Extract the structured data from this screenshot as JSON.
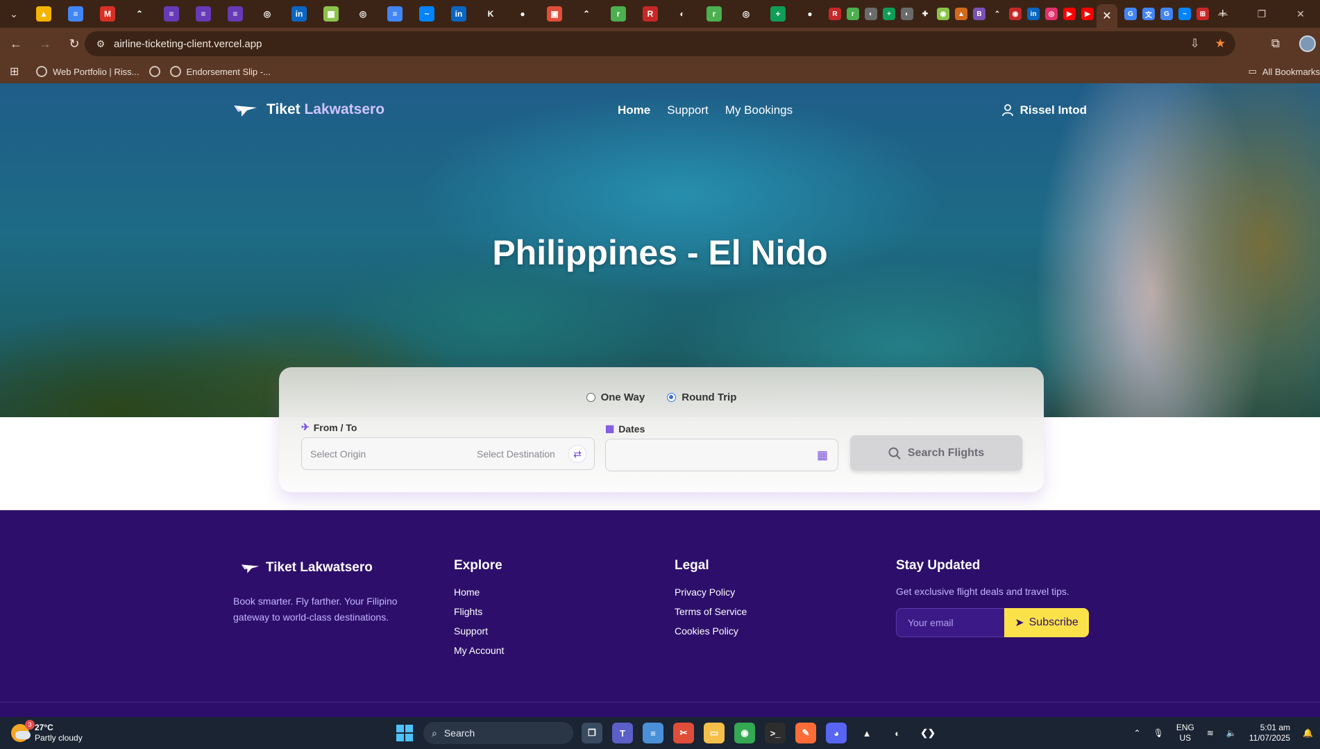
{
  "browser": {
    "url": "airline-ticketing-client.vercel.app",
    "close_tab_glyph": "✕",
    "new_tab_glyph": "+",
    "bookmarks": [
      {
        "label": "Web Portfolio | Riss..."
      },
      {
        "label": "Endorsement Slip -..."
      }
    ],
    "all_bookmarks_label": "All Bookmarks",
    "tabs": [
      {
        "icon": "drive-icon",
        "color": "#f4b400",
        "glyph": "▲"
      },
      {
        "icon": "docs-icon",
        "color": "#4285f4",
        "glyph": "≡"
      },
      {
        "icon": "gmail-icon",
        "color": "#d93025",
        "glyph": "M"
      },
      {
        "icon": "stream-icon",
        "color": "#3b2416",
        "glyph": "⌃"
      },
      {
        "icon": "forms-icon",
        "color": "#673ab7",
        "glyph": "≡"
      },
      {
        "icon": "forms-icon",
        "color": "#673ab7",
        "glyph": "≡"
      },
      {
        "icon": "forms-icon",
        "color": "#673ab7",
        "glyph": "≡"
      },
      {
        "icon": "openai-icon",
        "color": "#3b2416",
        "glyph": "◎"
      },
      {
        "icon": "linkedin-icon",
        "color": "#0a66c2",
        "glyph": "in"
      },
      {
        "icon": "image-icon",
        "color": "#8bc34a",
        "glyph": "▦"
      },
      {
        "icon": "openai-icon",
        "color": "#3b2416",
        "glyph": "◎"
      },
      {
        "icon": "docs-icon",
        "color": "#4285f4",
        "glyph": "≡"
      },
      {
        "icon": "messenger-icon",
        "color": "#0084ff",
        "glyph": "~"
      },
      {
        "icon": "linkedin-icon",
        "color": "#0a66c2",
        "glyph": "in"
      },
      {
        "icon": "kodekloud-icon",
        "color": "#3b2416",
        "glyph": "K"
      },
      {
        "icon": "github-icon",
        "color": "#3b2416",
        "glyph": "●"
      },
      {
        "icon": "calendar-icon",
        "color": "#e04e39",
        "glyph": "▣"
      },
      {
        "icon": "stream-icon",
        "color": "#3b2416",
        "glyph": "⌃"
      },
      {
        "icon": "rse-icon",
        "color": "#4caf50",
        "glyph": "r"
      },
      {
        "icon": "r-icon",
        "color": "#c62828",
        "glyph": "R"
      },
      {
        "icon": "globe-icon",
        "color": "#3b2416",
        "glyph": "◐"
      },
      {
        "icon": "rse-icon",
        "color": "#4caf50",
        "glyph": "r"
      },
      {
        "icon": "openai-icon",
        "color": "#3b2416",
        "glyph": "◎"
      },
      {
        "icon": "sheets-icon",
        "color": "#0f9d58",
        "glyph": "+"
      },
      {
        "icon": "github-icon",
        "color": "#3b2416",
        "glyph": "●"
      }
    ],
    "small_tabs": [
      {
        "icon": "r-icon",
        "color": "#c62828",
        "glyph": "R"
      },
      {
        "icon": "rse-icon",
        "color": "#4caf50",
        "glyph": "r"
      },
      {
        "icon": "globe-icon",
        "color": "#6b6b6b",
        "glyph": "◐"
      },
      {
        "icon": "sheets-icon",
        "color": "#0f9d58",
        "glyph": "+"
      },
      {
        "icon": "globe-icon",
        "color": "#6b6b6b",
        "glyph": "◐"
      },
      {
        "icon": "puzzle-icon",
        "color": "#3b2416",
        "glyph": "✚"
      },
      {
        "icon": "shield-icon",
        "color": "#8bc34a",
        "glyph": "◉"
      },
      {
        "icon": "cake-icon",
        "color": "#d2691e",
        "glyph": "▲"
      },
      {
        "icon": "bootstrap-icon",
        "color": "#7952b3",
        "glyph": "B"
      },
      {
        "icon": "stream-icon",
        "color": "#3b2416",
        "glyph": "⌃"
      },
      {
        "icon": "record-icon",
        "color": "#c62828",
        "glyph": "◉"
      },
      {
        "icon": "linkedin-icon",
        "color": "#0a66c2",
        "glyph": "in"
      },
      {
        "icon": "instagram-icon",
        "color": "#e1306c",
        "glyph": "◎"
      },
      {
        "icon": "youtube-icon",
        "color": "#ff0000",
        "glyph": "▶"
      },
      {
        "icon": "youtube-icon",
        "color": "#ff0000",
        "glyph": "▶"
      }
    ],
    "after_tabs": [
      {
        "icon": "google-icon",
        "color": "#4285f4",
        "glyph": "G"
      },
      {
        "icon": "translate-icon",
        "color": "#4285f4",
        "glyph": "文"
      },
      {
        "icon": "google-icon",
        "color": "#4285f4",
        "glyph": "G"
      },
      {
        "icon": "messenger-icon",
        "color": "#0084ff",
        "glyph": "~"
      },
      {
        "icon": "cart-icon",
        "color": "#c62828",
        "glyph": "⊞"
      }
    ]
  },
  "site": {
    "brand_first": "Tiket",
    "brand_second": "Lakwatsero",
    "nav": [
      {
        "label": "Home",
        "active": true
      },
      {
        "label": "Support",
        "active": false
      },
      {
        "label": "My Bookings",
        "active": false
      }
    ],
    "user_name": "Rissel Intod",
    "hero_title": "Philippines - El Nido",
    "search": {
      "trip_types": [
        {
          "label": "One Way",
          "checked": false
        },
        {
          "label": "Round Trip",
          "checked": true
        }
      ],
      "from_to_label": "From / To",
      "origin_placeholder": "Select Origin",
      "destination_placeholder": "Select Destination",
      "dates_label": "Dates",
      "dates_value": "",
      "search_button": "Search Flights"
    },
    "footer": {
      "brand": "Tiket Lakwatsero",
      "tagline": "Book smarter. Fly farther. Your Filipino gateway to world-class destinations.",
      "explore_title": "Explore",
      "explore_links": [
        "Home",
        "Flights",
        "Support",
        "My Account"
      ],
      "legal_title": "Legal",
      "legal_links": [
        "Privacy Policy",
        "Terms of Service",
        "Cookies Policy"
      ],
      "stay_title": "Stay Updated",
      "stay_text": "Get exclusive flight deals and travel tips.",
      "email_placeholder": "Your email",
      "subscribe_label": "Subscribe",
      "accent_color": "#fbe24a"
    }
  },
  "taskbar": {
    "weather_temp": "27°C",
    "weather_desc": "Partly cloudy",
    "weather_badge": "3",
    "search_label": "Search",
    "lang_top": "ENG",
    "lang_bottom": "US",
    "time": "5:01 am",
    "date": "11/07/2025",
    "apps": [
      {
        "icon": "task-view-icon",
        "color": "#3a4a60",
        "glyph": "❐"
      },
      {
        "icon": "teams-icon",
        "color": "#5b5fc7",
        "glyph": "T"
      },
      {
        "icon": "notepad-icon",
        "color": "#4a90d9",
        "glyph": "≡"
      },
      {
        "icon": "snipping-icon",
        "color": "#e04e39",
        "glyph": "✂"
      },
      {
        "icon": "file-explorer-icon",
        "color": "#f5c04a",
        "glyph": "▭"
      },
      {
        "icon": "chrome-icon",
        "color": "#34a853",
        "glyph": "◉"
      },
      {
        "icon": "terminal-icon",
        "color": "#2d2d2d",
        "glyph": ">_"
      },
      {
        "icon": "postman-icon",
        "color": "#ff6c37",
        "glyph": "✎"
      },
      {
        "icon": "discord-icon",
        "color": "#5865f2",
        "glyph": "◕"
      },
      {
        "icon": "mongodb-icon",
        "color": "#1a2433",
        "glyph": "▲"
      },
      {
        "icon": "spotify-icon",
        "color": "#1a2433",
        "glyph": "◐"
      },
      {
        "icon": "vscode-icon",
        "color": "#1a2433",
        "glyph": "❮❯"
      }
    ]
  }
}
